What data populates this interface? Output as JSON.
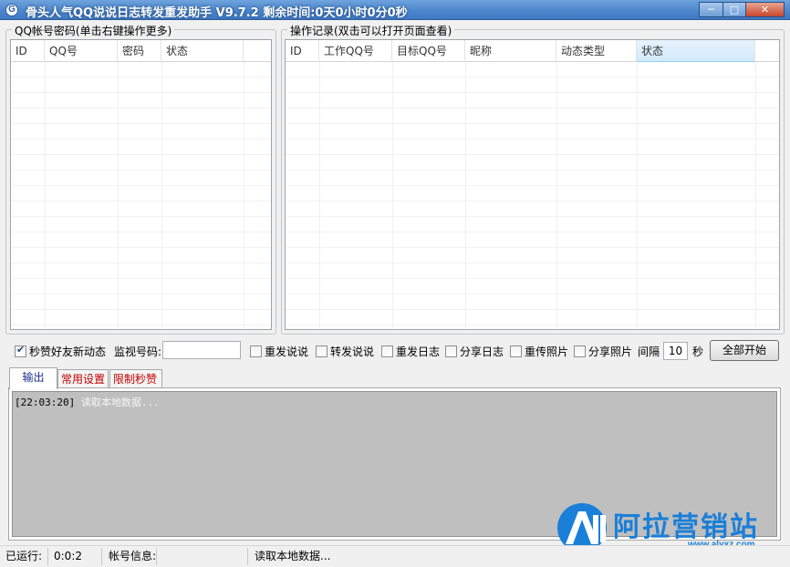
{
  "window": {
    "title": "骨头人气QQ说说日志转发重发助手 V9.7.2  剩余时间:0天0小时0分0秒",
    "icon_letter": "G",
    "minimize": "─",
    "maximize": "□",
    "close": "✕"
  },
  "accounts_panel": {
    "title": "QQ帐号密码(单击右键操作更多)",
    "columns": [
      "ID",
      "QQ号",
      "密码",
      "状态"
    ]
  },
  "records_panel": {
    "title": "操作记录(双击可以打开页面查看)",
    "columns": [
      "ID",
      "工作QQ号",
      "目标QQ号",
      "昵称",
      "动态类型",
      "状态"
    ]
  },
  "options": {
    "like_friends": {
      "label": "秒赞好友新动态",
      "checked": true
    },
    "monitor_label": "监视号码:",
    "monitor_value": "",
    "repost_shuoshuo": {
      "label": "重发说说",
      "checked": false
    },
    "forward_shuoshuo": {
      "label": "转发说说",
      "checked": false
    },
    "repost_log": {
      "label": "重发日志",
      "checked": false
    },
    "share_log": {
      "label": "分享日志",
      "checked": false
    },
    "reupload_photo": {
      "label": "重传照片",
      "checked": false
    },
    "share_photo": {
      "label": "分享照片",
      "checked": false
    },
    "interval_label": "间隔",
    "interval_value": "10",
    "interval_unit": "秒",
    "start_all": "全部开始"
  },
  "tabs": [
    "输出",
    "常用设置",
    "限制秒赞"
  ],
  "log": [
    {
      "time": "[22:03:20]",
      "message": "读取本地数据..."
    }
  ],
  "watermark": {
    "mark": "A",
    "text": "阿拉营销站",
    "url": "www.alyxz.com"
  },
  "statusbar": {
    "running_label": "已运行:",
    "running_value": "0:0:2",
    "account_label": "帐号信息:",
    "account_value": "",
    "message": "读取本地数据..."
  },
  "colors": {
    "title_bar": "#4d87cc",
    "tab_red": "#c00000",
    "watermark_blue": "#1a7fd8"
  }
}
